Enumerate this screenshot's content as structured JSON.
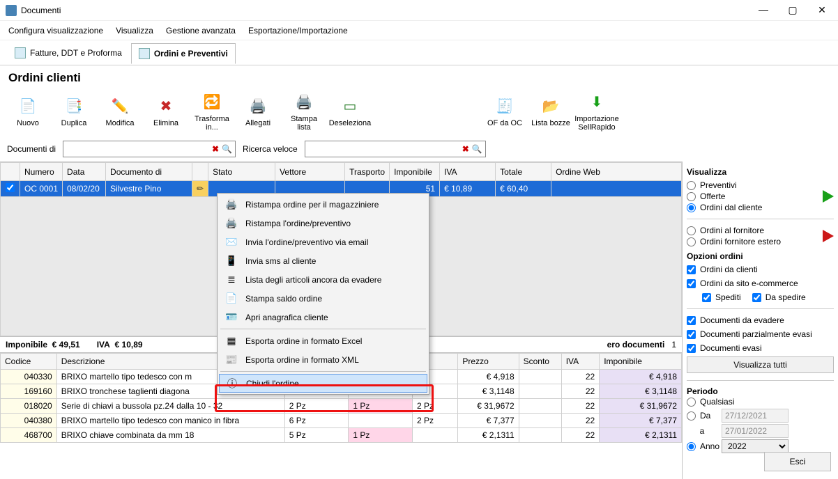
{
  "window": {
    "title": "Documenti",
    "min": "—",
    "max": "▢",
    "close": "✕"
  },
  "menu": [
    "Configura visualizzazione",
    "Visualizza",
    "Gestione avanzata",
    "Esportazione/Importazione"
  ],
  "tabs": [
    {
      "label": "Fatture, DDT e Proforma"
    },
    {
      "label": "Ordini e Preventivi"
    }
  ],
  "section_title": "Ordini clienti",
  "toolbar": [
    {
      "label": "Nuovo",
      "glyph": "📄",
      "name": "new-button"
    },
    {
      "label": "Duplica",
      "glyph": "📑",
      "name": "duplicate-button"
    },
    {
      "label": "Modifica",
      "glyph": "✏️",
      "name": "edit-button"
    },
    {
      "label": "Elimina",
      "glyph": "✖",
      "name": "delete-button",
      "color": "#c62828"
    },
    {
      "label": "Trasforma in...",
      "glyph": "🔁",
      "name": "transform-button"
    },
    {
      "label": "Allegati",
      "glyph": "🖨️",
      "name": "attachments-button"
    },
    {
      "label": "Stampa lista",
      "glyph": "🖨️",
      "name": "print-list-button"
    },
    {
      "label": "Deseleziona",
      "glyph": "▭",
      "name": "deselect-button"
    }
  ],
  "toolbar_right": [
    {
      "label": "OF da OC",
      "glyph": "🧾",
      "name": "of-da-oc-button"
    },
    {
      "label": "Lista bozze",
      "glyph": "📂",
      "name": "drafts-button"
    },
    {
      "label": "Importazione SellRapido",
      "glyph": "⬇",
      "name": "import-sellrapido-button",
      "color": "#18a018"
    }
  ],
  "filters": {
    "doc_label": "Documenti di",
    "quick_label": "Ricerca veloce"
  },
  "order_headers": [
    "",
    "Numero",
    "Data",
    "Documento di",
    "",
    "Stato",
    "Vettore",
    "Trasporto",
    "Imponibile",
    "IVA",
    "Totale",
    "Ordine Web"
  ],
  "order_row": {
    "numero": "OC 0001",
    "data": "08/02/20",
    "docdi": "Silvestre Pino",
    "imponibile_partial": "51",
    "iva": "€ 10,89",
    "totale": "€ 60,40"
  },
  "ctx": [
    {
      "label": "Ristampa ordine per il magazziniere",
      "glyph": "🖨️",
      "name": "ctx-reprint-warehouse"
    },
    {
      "label": "Ristampa l'ordine/preventivo",
      "glyph": "🖨️",
      "name": "ctx-reprint-order"
    },
    {
      "label": "Invia l'ordine/preventivo via email",
      "glyph": "✉️",
      "name": "ctx-email-order"
    },
    {
      "label": "Invia sms al cliente",
      "glyph": "📱",
      "name": "ctx-sms-client"
    },
    {
      "label": "Lista degli articoli ancora da evadere",
      "glyph": "≣",
      "name": "ctx-pending-items"
    },
    {
      "label": "Stampa saldo ordine",
      "glyph": "📄",
      "name": "ctx-print-balance"
    },
    {
      "label": "Apri anagrafica cliente",
      "glyph": "🪪",
      "name": "ctx-open-customer"
    },
    {
      "sep": true
    },
    {
      "label": "Esporta ordine in formato Excel",
      "glyph": "▦",
      "name": "ctx-export-excel"
    },
    {
      "label": "Esporta ordine in formato XML",
      "glyph": "📰",
      "name": "ctx-export-xml"
    },
    {
      "sep": true
    },
    {
      "label": "Chiudi l'ordine",
      "glyph": "ⓘ",
      "sel": true,
      "name": "ctx-close-order"
    }
  ],
  "totals": {
    "imponibile_label": "Imponibile",
    "imponibile": "€ 49,51",
    "iva_label": "IVA",
    "iva": "€ 10,89",
    "ndocs_label": "ero documenti",
    "ndocs": "1"
  },
  "detail_headers": [
    "Codice",
    "Descrizione",
    "",
    "",
    "",
    "Prezzo",
    "Sconto",
    "IVA",
    "Imponibile"
  ],
  "detail_rows": [
    {
      "codice": "040330",
      "descr": "BRIXO martello tipo tedesco con m",
      "q1": "",
      "q2": "",
      "q3": "",
      "prezzo": "€ 4,918",
      "sconto": "",
      "iva": "22",
      "imp": "€ 4,918"
    },
    {
      "codice": "169160",
      "descr": "BRIXO tronchese taglienti diagona",
      "q1": "",
      "q2": "",
      "q3": "",
      "prezzo": "€ 3,1148",
      "sconto": "",
      "iva": "22",
      "imp": "€ 3,1148"
    },
    {
      "codice": "018020",
      "descr": "Serie di chiavi a bussola  pz.24 dalla 10 - 32",
      "q1": "2 Pz",
      "q2": "1 Pz",
      "q3": "2 Pz",
      "prezzo": "€ 31,9672",
      "sconto": "",
      "iva": "22",
      "imp": "€ 31,9672"
    },
    {
      "codice": "040380",
      "descr": "BRIXO martello tipo tedesco con manico in fibra",
      "q1": "6 Pz",
      "q2": "",
      "q3": "2 Pz",
      "prezzo": "€ 7,377",
      "sconto": "",
      "iva": "22",
      "imp": "€ 7,377"
    },
    {
      "codice": "468700",
      "descr": "BRIXO chiave combinata da mm 18",
      "q1": "5 Pz",
      "q2": "1 Pz",
      "q3": "",
      "prezzo": "€ 2,1311",
      "sconto": "",
      "iva": "22",
      "imp": "€ 2,1311"
    }
  ],
  "side": {
    "visualizza": "Visualizza",
    "r1": "Preventivi",
    "r2": "Offerte",
    "r3": "Ordini dal cliente",
    "r4": "Ordini al fornitore",
    "r5": "Ordini fornitore estero",
    "opzioni": "Opzioni ordini",
    "c1": "Ordini da clienti",
    "c2": "Ordini da sito e-commerce",
    "c2a": "Spediti",
    "c2b": "Da spedire",
    "c3": "Documenti da evadere",
    "c4": "Documenti parzialmente evasi",
    "c5": "Documenti evasi",
    "btn_all": "Visualizza tutti",
    "periodo": "Periodo",
    "p1": "Qualsiasi",
    "p2": "Da",
    "p2a": "a",
    "d1": "27/12/2021",
    "d2": "27/01/2022",
    "p3": "Anno",
    "anno": "2022",
    "esci": "Esci"
  }
}
